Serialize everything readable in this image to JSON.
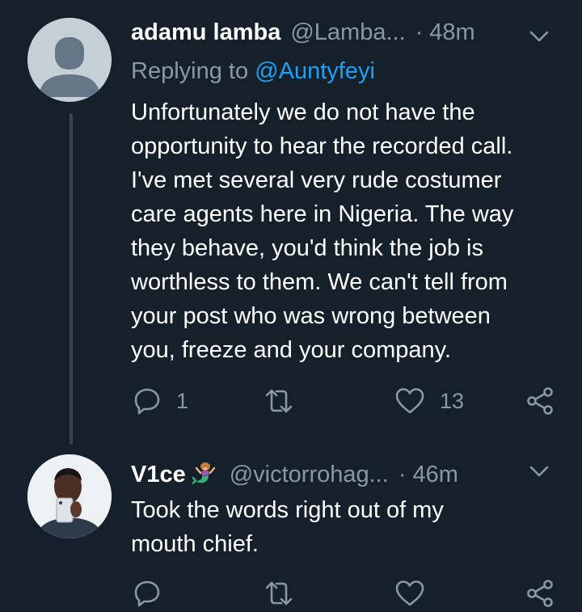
{
  "tweets": [
    {
      "name": "adamu lamba",
      "handle": "@Lamba...",
      "separator": "·",
      "time": "48m",
      "replying_label": "Replying to",
      "replying_to": "@Auntyfeyi",
      "text": "Unfortunately we do not have the\nopportunity to hear the recorded call.\nI've met several very rude costumer\ncare agents here in Nigeria. The way\nthey behave, you'd think the job is\nworthless to them. We can't tell from\nyour post who was wrong between\nyou, freeze and your company.",
      "reply_count": "1",
      "retweet_count": "",
      "like_count": "13"
    },
    {
      "name": "V1ce",
      "name_emoji": "mermaid-emoji",
      "handle": "@victorrohag...",
      "separator": "·",
      "time": "46m",
      "text": "Took the words right out of my\nmouth chief.",
      "reply_count": "",
      "retweet_count": "",
      "like_count": ""
    }
  ],
  "icons": {
    "reply": "reply-icon",
    "retweet": "retweet-icon",
    "like": "heart-icon",
    "share": "share-icon",
    "more": "chevron-down-icon"
  },
  "colors": {
    "background": "#15202b",
    "muted": "#8899a6",
    "link": "#1da1f2",
    "thread_line": "#38444d"
  }
}
